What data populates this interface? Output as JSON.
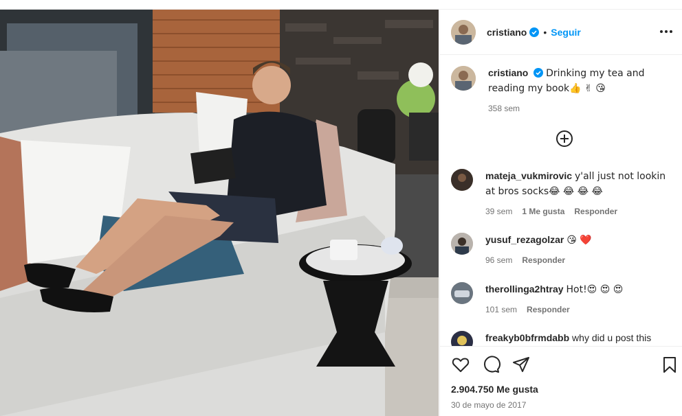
{
  "post": {
    "username": "cristiano",
    "follow_label": "Seguir",
    "dot": "•",
    "caption": "Drinking my tea and reading my book👍 ✌ 😘",
    "caption_time": "358 sem",
    "likes": "2.904.750 Me gusta",
    "date": "30 de mayo de 2017"
  },
  "comments": [
    {
      "username": "mateja_vukmirovic",
      "text": "y'all just not lookin at bros socks😂 😂 😂 😂",
      "time": "39 sem",
      "likes_label": "1 Me gusta",
      "reply_label": "Responder"
    },
    {
      "username": "yusuf_rezagolzar",
      "text": "😘 ❤️",
      "time": "96 sem",
      "reply_label": "Responder"
    },
    {
      "username": "therollinga2htray",
      "text": "Hot!😍 😍 😍",
      "time": "101 sem",
      "reply_label": "Responder"
    },
    {
      "username": "freakyb0bfrmdabb",
      "text": "why did u post this"
    }
  ],
  "colors": {
    "accent": "#0095f6",
    "text": "#262626",
    "muted": "#737373",
    "border": "#efefef"
  },
  "icons": [
    "verified-badge-icon",
    "more-options-icon",
    "add-circle-icon",
    "heart-icon",
    "comment-icon",
    "share-icon",
    "bookmark-icon"
  ]
}
